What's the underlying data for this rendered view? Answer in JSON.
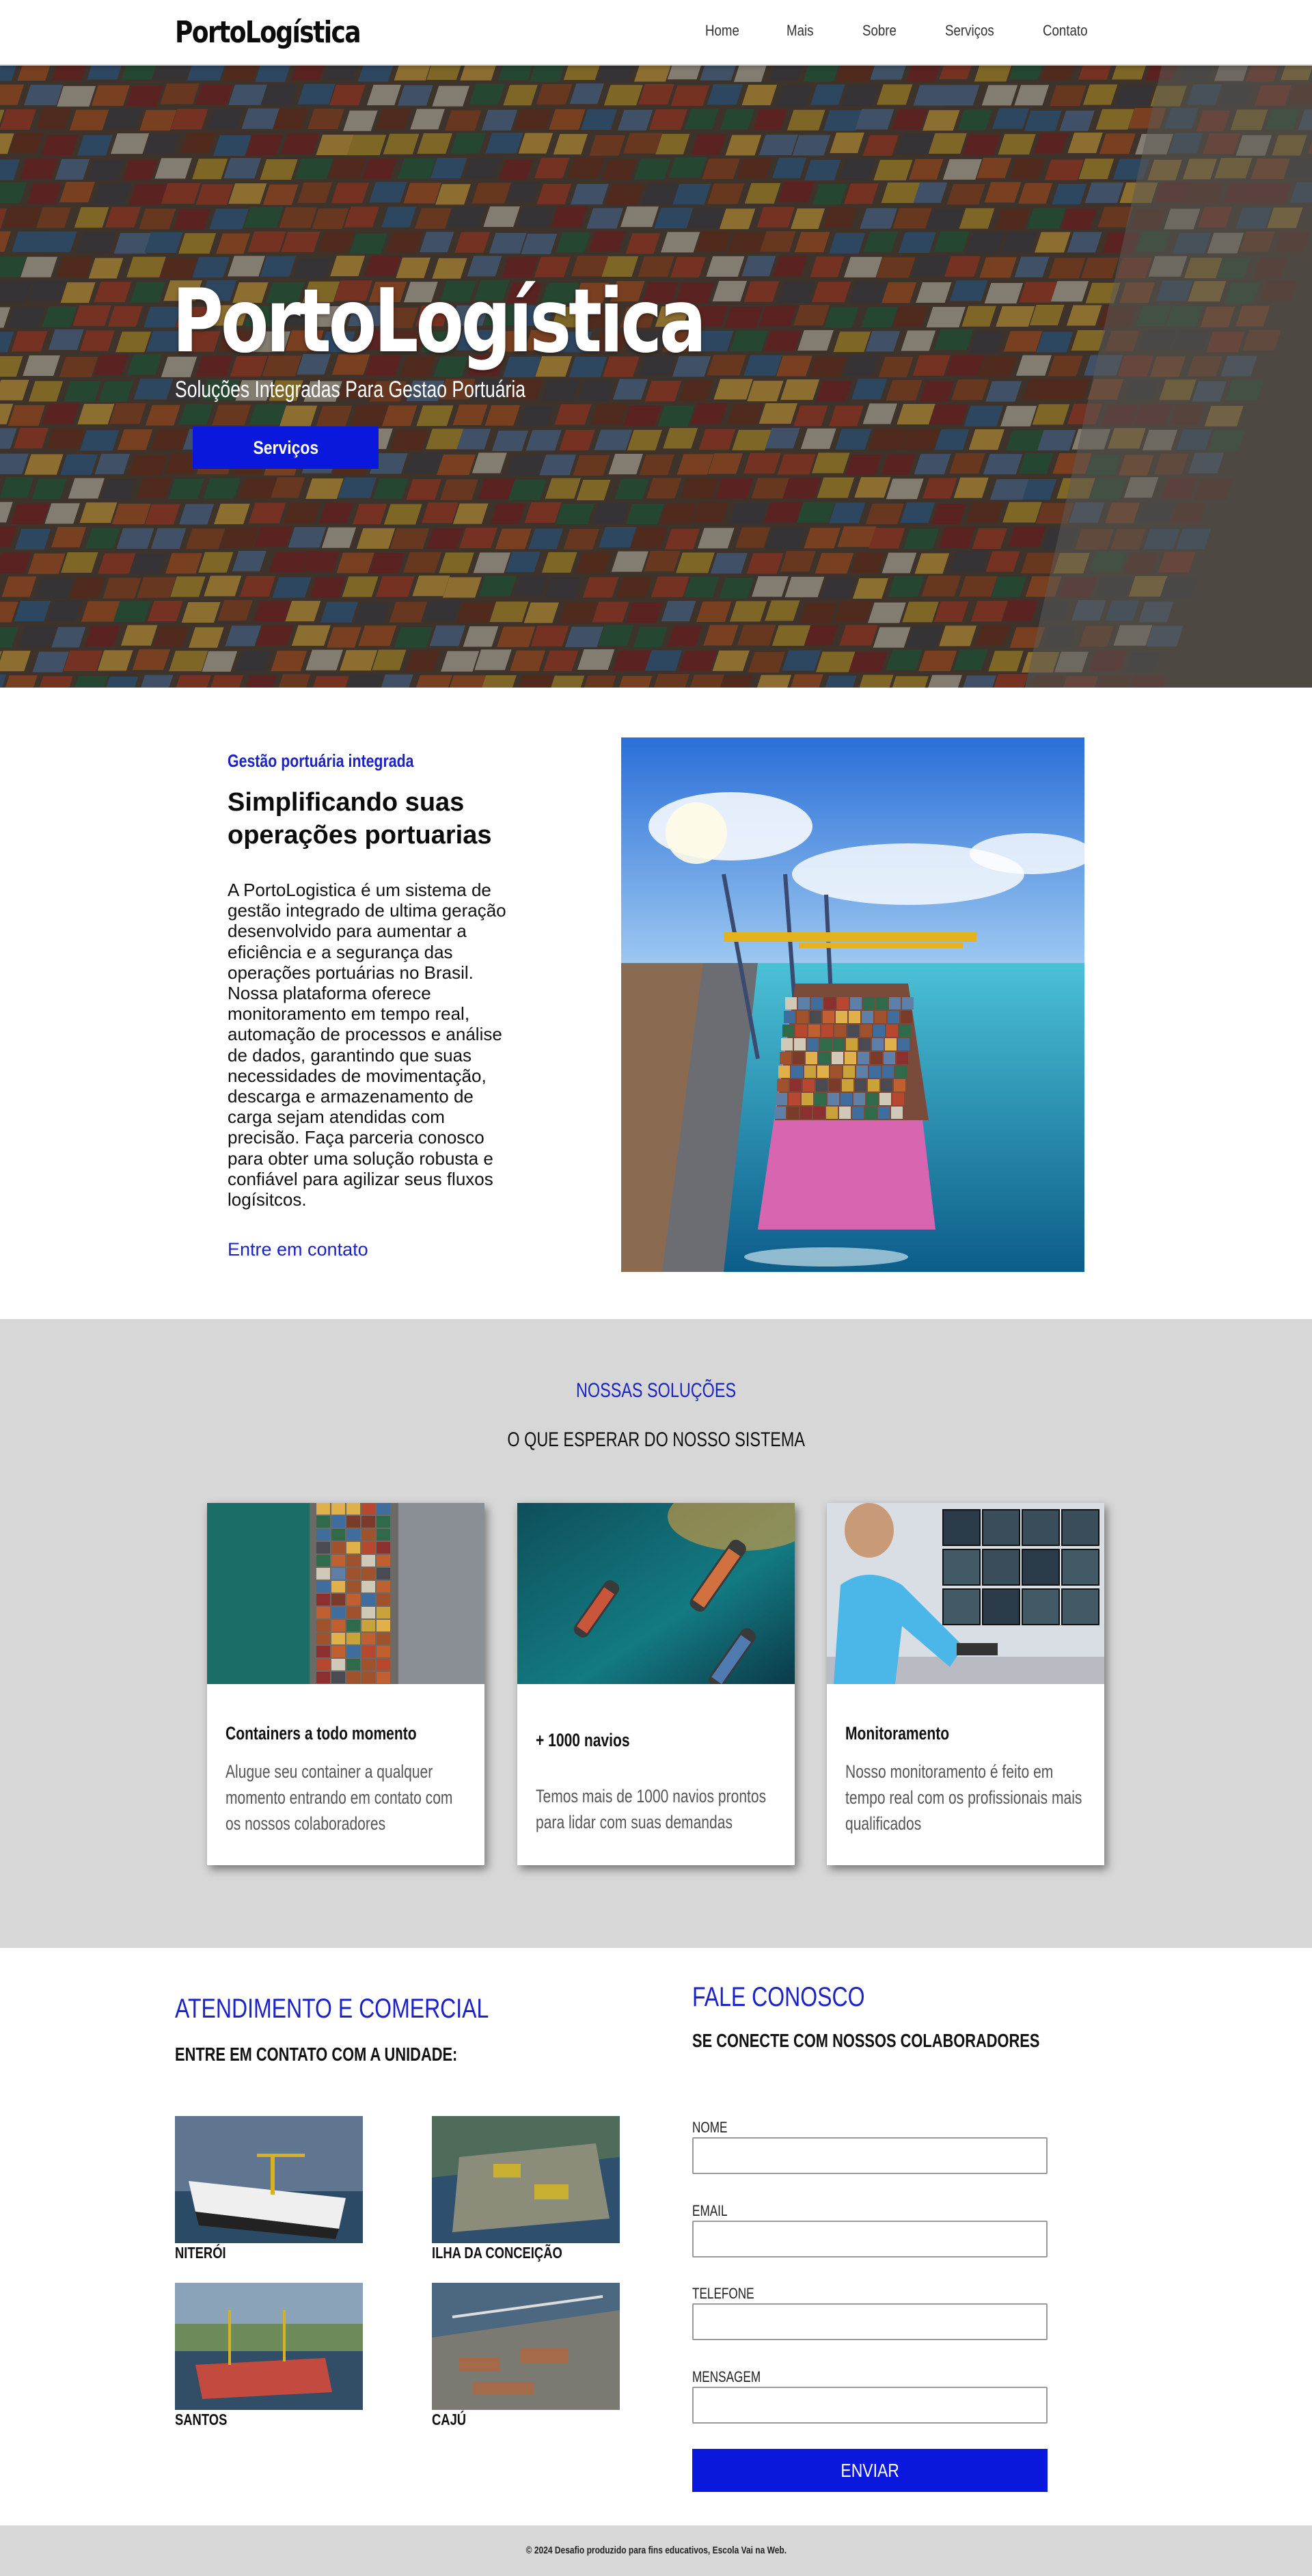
{
  "header": {
    "logo": "PortoLogística",
    "nav": [
      "Home",
      "Mais",
      "Sobre",
      "Serviços",
      "Contato"
    ]
  },
  "hero": {
    "title": "PortoLogística",
    "subtitle": "Soluções Integradas Para Gestao Portuária",
    "button": "Serviços"
  },
  "about": {
    "kicker": "Gestão portuária integrada",
    "title": "Simplificando suas operações portuarias",
    "body": "A PortoLogistica é um sistema de gestão integrado de ultima geração desenvolvido para aumentar a eficiência e a segurança das operações portuárias no Brasil. Nossa plataforma oferece monitoramento em tempo real, automação de processos e análise de dados, garantindo que suas necessidades de movimentação, descarga e armazenamento de carga sejam atendidas com precisão. Faça parceria conosco para obter uma solução robusta e confiável para agilizar seus fluxos logísitcos.",
    "link": "Entre em contato"
  },
  "solutions": {
    "kicker": "NOSSAS SOLUÇÕES",
    "title": "O QUE ESPERAR DO NOSSO SISTEMA",
    "cards": [
      {
        "title": "Containers a todo momento",
        "text": "Alugue seu container a qualquer momento entrando em contato com os nossos colaboradores"
      },
      {
        "title": "+ 1000 navios",
        "text": "Temos mais de 1000 navios prontos para lidar com suas demandas"
      },
      {
        "title": "Monitoramento",
        "text": "Nosso monitoramento é feito em tempo real com os profissionais mais qualificados"
      }
    ]
  },
  "contact": {
    "left_title": "ATENDIMENTO E COMERCIAL",
    "left_sub": "ENTRE EM CONTATO COM A UNIDADE:",
    "units": [
      "NITERÓI",
      "ILHA DA CONCEIÇÃO",
      "SANTOS",
      "CAJÚ"
    ],
    "right_title": "FALE CONOSCO",
    "right_sub": "SE CONECTE COM NOSSOS COLABORADORES",
    "fields": [
      "NOME",
      "EMAIL",
      "TELEFONE",
      "MENSAGEM"
    ],
    "button": "ENVIAR"
  },
  "footer": {
    "text": "© 2024 Desafio produzido para fins educativos, Escola Vai na Web."
  },
  "colors": {
    "accent": "#0a17dc",
    "link": "#1a22c8",
    "section_bg": "#d7d7d7"
  }
}
